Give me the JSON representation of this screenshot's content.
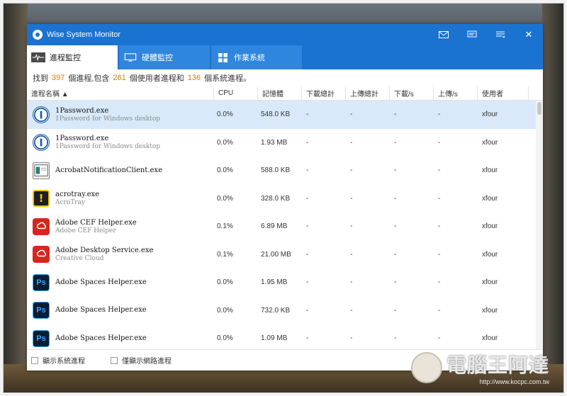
{
  "app": {
    "title": "Wise System Monitor",
    "accent": "#1a73d1"
  },
  "titlebar_buttons": [
    {
      "name": "mail-icon"
    },
    {
      "name": "feedback-icon"
    },
    {
      "name": "menu-icon"
    },
    {
      "name": "close-icon",
      "label": "✕"
    }
  ],
  "tabs": [
    {
      "label": "進程監控",
      "icon": "process-monitor-icon",
      "active": true
    },
    {
      "label": "硬體監控",
      "icon": "hardware-monitor-icon",
      "active": false
    },
    {
      "label": "作業系統",
      "icon": "windows-logo-icon",
      "active": false
    }
  ],
  "summary": {
    "prefix": "找到",
    "total": "397",
    "mid1": "個進程,包含",
    "user_count": "261",
    "mid2": "個使用者進程和",
    "system_count": "136",
    "suffix": "個系統進程。"
  },
  "columns": {
    "name": "進程名稱 ▲",
    "cpu": "CPU",
    "memory": "記憶體",
    "download_total": "下載總計",
    "upload_total": "上傳總計",
    "download_rate": "下載/s",
    "upload_rate": "上傳/s",
    "user": "使用者"
  },
  "processes": [
    {
      "name": "1Password.exe",
      "desc": "1Password for Windows desktop",
      "cpu": "0.0%",
      "mem": "548.0 KB",
      "dl": "-",
      "ul": "-",
      "dls": "-",
      "uls": "-",
      "user": "xfour",
      "icon": "onepassword-icon",
      "selected": true
    },
    {
      "name": "1Password.exe",
      "desc": "1Password for Windows desktop",
      "cpu": "0.0%",
      "mem": "1.93 MB",
      "dl": "-",
      "ul": "-",
      "dls": "-",
      "uls": "-",
      "user": "xfour",
      "icon": "onepassword-icon"
    },
    {
      "name": "AcrobatNotificationClient.exe",
      "desc": "",
      "cpu": "0.0%",
      "mem": "588.0 KB",
      "dl": "-",
      "ul": "-",
      "dls": "-",
      "uls": "-",
      "user": "xfour",
      "icon": "acrobat-notification-icon"
    },
    {
      "name": "acrotray.exe",
      "desc": "AcroTray",
      "cpu": "0.0%",
      "mem": "328.0 KB",
      "dl": "-",
      "ul": "-",
      "dls": "-",
      "uls": "-",
      "user": "xfour",
      "icon": "acrotray-warning-icon"
    },
    {
      "name": "Adobe CEF Helper.exe",
      "desc": "Adobe CEF Helper",
      "cpu": "0.1%",
      "mem": "6.89 MB",
      "dl": "-",
      "ul": "-",
      "dls": "-",
      "uls": "-",
      "user": "xfour",
      "icon": "adobe-creative-cloud-icon"
    },
    {
      "name": "Adobe Desktop Service.exe",
      "desc": "Creative Cloud",
      "cpu": "0.1%",
      "mem": "21.00 MB",
      "dl": "-",
      "ul": "-",
      "dls": "-",
      "uls": "-",
      "user": "xfour",
      "icon": "adobe-creative-cloud-icon"
    },
    {
      "name": "Adobe Spaces Helper.exe",
      "desc": "",
      "cpu": "0.0%",
      "mem": "1.95 MB",
      "dl": "-",
      "ul": "-",
      "dls": "-",
      "uls": "-",
      "user": "xfour",
      "icon": "photoshop-icon"
    },
    {
      "name": "Adobe Spaces Helper.exe",
      "desc": "",
      "cpu": "0.0%",
      "mem": "732.0 KB",
      "dl": "-",
      "ul": "-",
      "dls": "-",
      "uls": "-",
      "user": "xfour",
      "icon": "photoshop-icon"
    },
    {
      "name": "Adobe Spaces Helper.exe",
      "desc": "",
      "cpu": "0.0%",
      "mem": "1.09 MB",
      "dl": "-",
      "ul": "-",
      "dls": "-",
      "uls": "-",
      "user": "xfour",
      "icon": "photoshop-icon"
    }
  ],
  "icon_labels": {
    "photoshop": "Ps",
    "acrotray": "!"
  },
  "footer": {
    "show_system": "顯示系統進程",
    "show_network": "僅顯示網路進程"
  },
  "watermark": {
    "title": "電腦王阿達",
    "url": "http://www.kocpc.com.tw"
  }
}
